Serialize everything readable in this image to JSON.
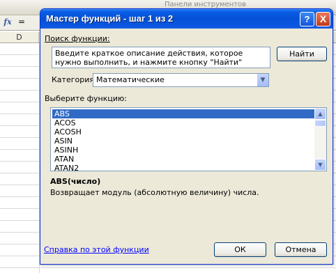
{
  "background": {
    "panel_title": "Панели инструментов",
    "fx_label": "fx",
    "formula_value": "=",
    "column_header": "D"
  },
  "dialog": {
    "title": "Мастер функций - шаг 1 из 2",
    "help_button": "?",
    "close_button": "X",
    "search_label": "Поиск функции:",
    "search_text": "Введите краткое описание действия, которое нужно выполнить, и нажмите кнопку \"Найти\"",
    "find_button": "Найти",
    "category_label": "Категория:",
    "category_value": "Математические",
    "select_label": "Выберите функцию:",
    "functions": [
      "ABS",
      "ACOS",
      "ACOSH",
      "ASIN",
      "ASINH",
      "ATAN",
      "ATAN2"
    ],
    "selected_function": "ABS",
    "signature": "ABS(число)",
    "description": "Возвращает модуль (абсолютную величину) числа.",
    "help_link": "Справка по этой функции",
    "ok_button": "ОК",
    "cancel_button": "Отмена"
  },
  "colors": {
    "title_bar": "#0551d6",
    "dialog_bg": "#ece9d8",
    "selection": "#316ac5",
    "link": "#0000ff"
  }
}
